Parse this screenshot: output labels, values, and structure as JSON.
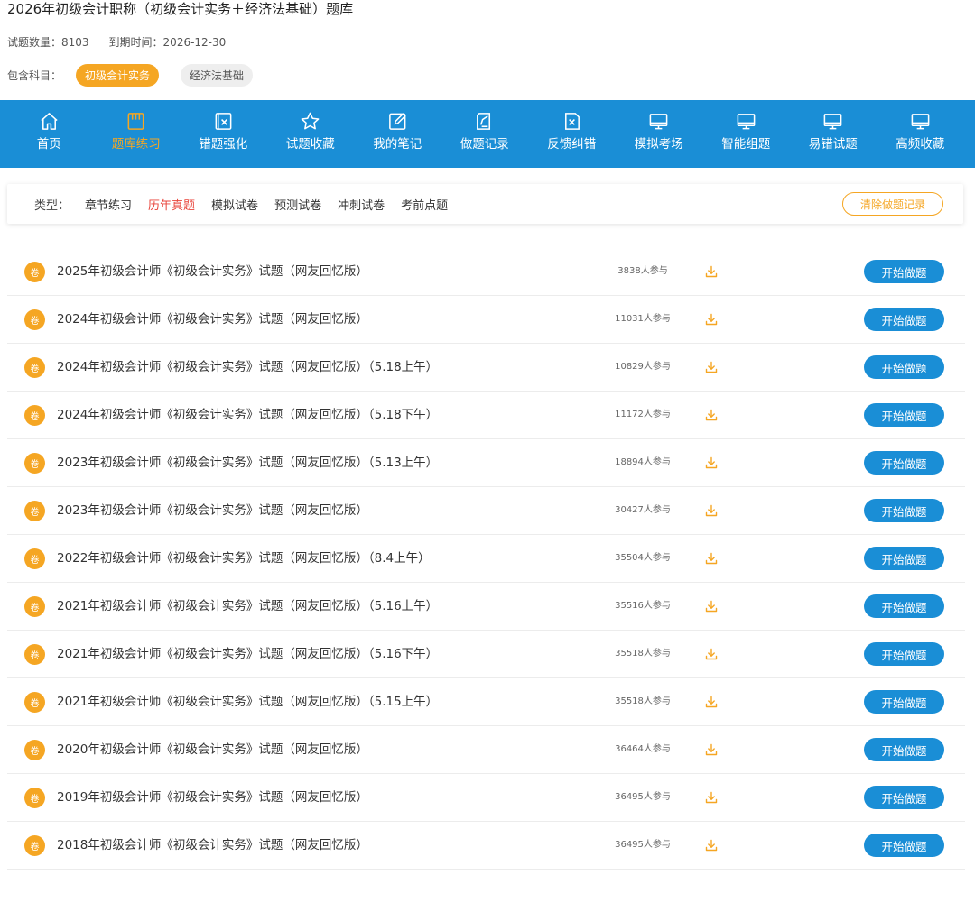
{
  "header": {
    "title": "2026年初级会计职称（初级会计实务＋经济法基础）题库",
    "question_count": "试题数量：8103",
    "expiry": "到期时间：2026-12-30",
    "subjects_label": "包含科目：",
    "subjects": [
      {
        "label": "初级会计实务",
        "active": true
      },
      {
        "label": "经济法基础",
        "active": false
      }
    ]
  },
  "nav": {
    "items": [
      {
        "label": "首页",
        "icon": "home-icon"
      },
      {
        "label": "题库练习",
        "icon": "book-icon",
        "active": true
      },
      {
        "label": "错题强化",
        "icon": "wrong-icon"
      },
      {
        "label": "试题收藏",
        "icon": "star-icon"
      },
      {
        "label": "我的笔记",
        "icon": "edit-icon"
      },
      {
        "label": "做题记录",
        "icon": "record-icon"
      },
      {
        "label": "反馈纠错",
        "icon": "feedback-icon"
      },
      {
        "label": "模拟考场",
        "icon": "monitor-icon"
      },
      {
        "label": "智能组题",
        "icon": "monitor-icon"
      },
      {
        "label": "易错试题",
        "icon": "monitor-icon"
      },
      {
        "label": "高频收藏",
        "icon": "monitor-icon"
      }
    ]
  },
  "filter": {
    "label": "类型：",
    "options": [
      "章节练习",
      "历年真题",
      "模拟试卷",
      "预测试卷",
      "冲刺试卷",
      "考前点题"
    ],
    "active_index": 1,
    "clear_label": "清除做题记录"
  },
  "list": {
    "badge": "卷",
    "start_label": "开始做题",
    "rows": [
      {
        "title": "2025年初级会计师《初级会计实务》试题（网友回忆版）",
        "count": "3838人参与"
      },
      {
        "title": "2024年初级会计师《初级会计实务》试题（网友回忆版）",
        "count": "11031人参与"
      },
      {
        "title": "2024年初级会计师《初级会计实务》试题（网友回忆版）（5.18上午）",
        "count": "10829人参与"
      },
      {
        "title": "2024年初级会计师《初级会计实务》试题（网友回忆版）（5.18下午）",
        "count": "11172人参与"
      },
      {
        "title": "2023年初级会计师《初级会计实务》试题（网友回忆版）（5.13上午）",
        "count": "18894人参与"
      },
      {
        "title": "2023年初级会计师《初级会计实务》试题（网友回忆版）",
        "count": "30427人参与"
      },
      {
        "title": "2022年初级会计师《初级会计实务》试题（网友回忆版）（8.4上午）",
        "count": "35504人参与"
      },
      {
        "title": "2021年初级会计师《初级会计实务》试题（网友回忆版）（5.16上午）",
        "count": "35516人参与"
      },
      {
        "title": "2021年初级会计师《初级会计实务》试题（网友回忆版）（5.16下午）",
        "count": "35518人参与"
      },
      {
        "title": "2021年初级会计师《初级会计实务》试题（网友回忆版）（5.15上午）",
        "count": "35518人参与"
      },
      {
        "title": "2020年初级会计师《初级会计实务》试题（网友回忆版）",
        "count": "36464人参与"
      },
      {
        "title": "2019年初级会计师《初级会计实务》试题（网友回忆版）",
        "count": "36495人参与"
      },
      {
        "title": "2018年初级会计师《初级会计实务》试题（网友回忆版）",
        "count": "36495人参与"
      }
    ]
  },
  "colors": {
    "nav_bg": "#1a8ed6",
    "accent_orange": "#f5a623",
    "active_red": "#e8453c",
    "button_blue": "#1a8ed6"
  }
}
